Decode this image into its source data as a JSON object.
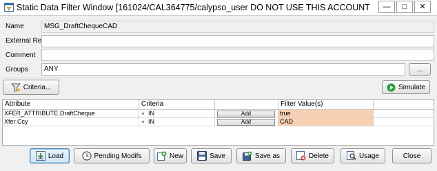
{
  "window": {
    "title": "Static Data Filter Window  [161024/CAL364775/calypso_user DO NOT USE THIS ACCOUNT FOR TRA...",
    "minimize_glyph": "—",
    "maximize_glyph": "□",
    "close_glyph": "✕"
  },
  "form": {
    "name_label": "Name",
    "name_value": "MSG_DraftChequeCAD",
    "external_ref_label": "External Ref.",
    "external_ref_value": "",
    "comment_label": "Comment",
    "comment_value": "",
    "groups_label": "Groups",
    "groups_value": "ANY",
    "groups_browse_label": "..."
  },
  "toolbar": {
    "criteria_label": "Criteria...",
    "simulate_label": "Simulate"
  },
  "table": {
    "headers": [
      "Attribute",
      "Criteria",
      "",
      "Filter Value(s)",
      ""
    ],
    "rows": [
      {
        "attribute": "XFER_ATTRIBUTE.DraftCheque",
        "criteria": "IN",
        "add_label": "Add",
        "filter_value": "true"
      },
      {
        "attribute": "Xfer Ccy",
        "criteria": "IN",
        "add_label": "Add",
        "filter_value": "CAD"
      }
    ]
  },
  "buttons": {
    "load": "Load",
    "pending_modifs": "Pending Modifs",
    "new": "New",
    "save": "Save",
    "save_as": "Save as",
    "delete": "Delete",
    "usage": "Usage",
    "close": "Close"
  },
  "colors": {
    "filter_value_bg": "#f9d0b1",
    "simulate_icon": "#2e9b3a",
    "load_focus_border": "#3c7fb1"
  },
  "icons": {
    "app": "filter-window-icon",
    "criteria": "funnel-icon",
    "simulate": "play-icon",
    "load": "load-icon",
    "pending_modifs": "clock-icon",
    "new": "new-icon",
    "save": "floppy-icon",
    "save_as": "save-as-icon",
    "delete": "delete-icon",
    "usage": "magnifier-icon"
  }
}
